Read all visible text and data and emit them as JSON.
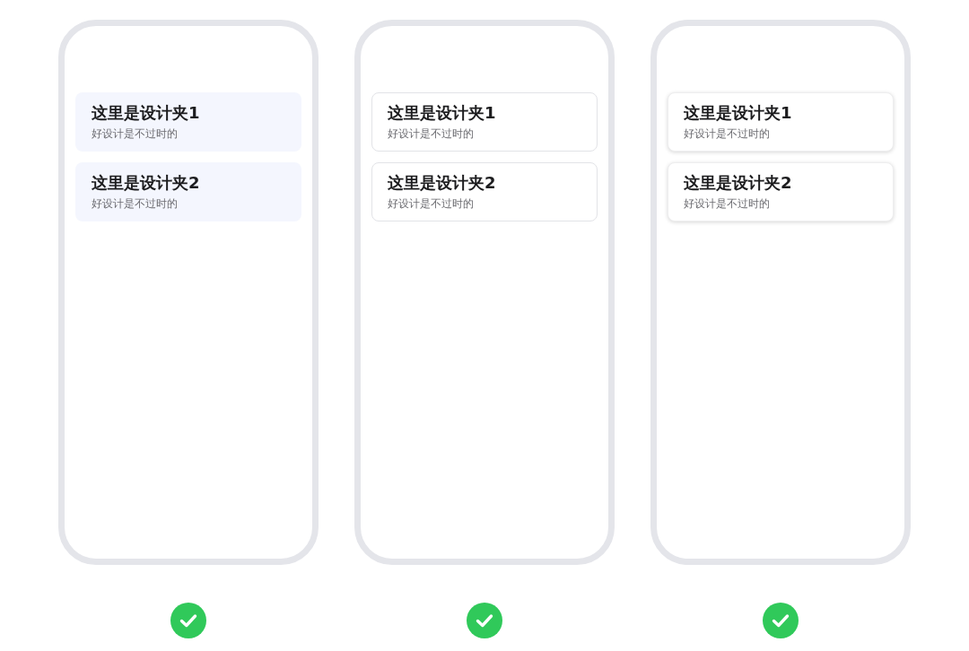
{
  "phones": [
    {
      "kind": "filled",
      "cards": [
        {
          "title": "这里是设计夹1",
          "subtitle": "好设计是不过时的"
        },
        {
          "title": "这里是设计夹2",
          "subtitle": "好设计是不过时的"
        }
      ]
    },
    {
      "kind": "outlined",
      "cards": [
        {
          "title": "这里是设计夹1",
          "subtitle": "好设计是不过时的"
        },
        {
          "title": "这里是设计夹2",
          "subtitle": "好设计是不过时的"
        }
      ]
    },
    {
      "kind": "shadowed",
      "cards": [
        {
          "title": "这里是设计夹1",
          "subtitle": "好设计是不过时的"
        },
        {
          "title": "这里是设计夹2",
          "subtitle": "好设计是不过时的"
        }
      ]
    }
  ]
}
